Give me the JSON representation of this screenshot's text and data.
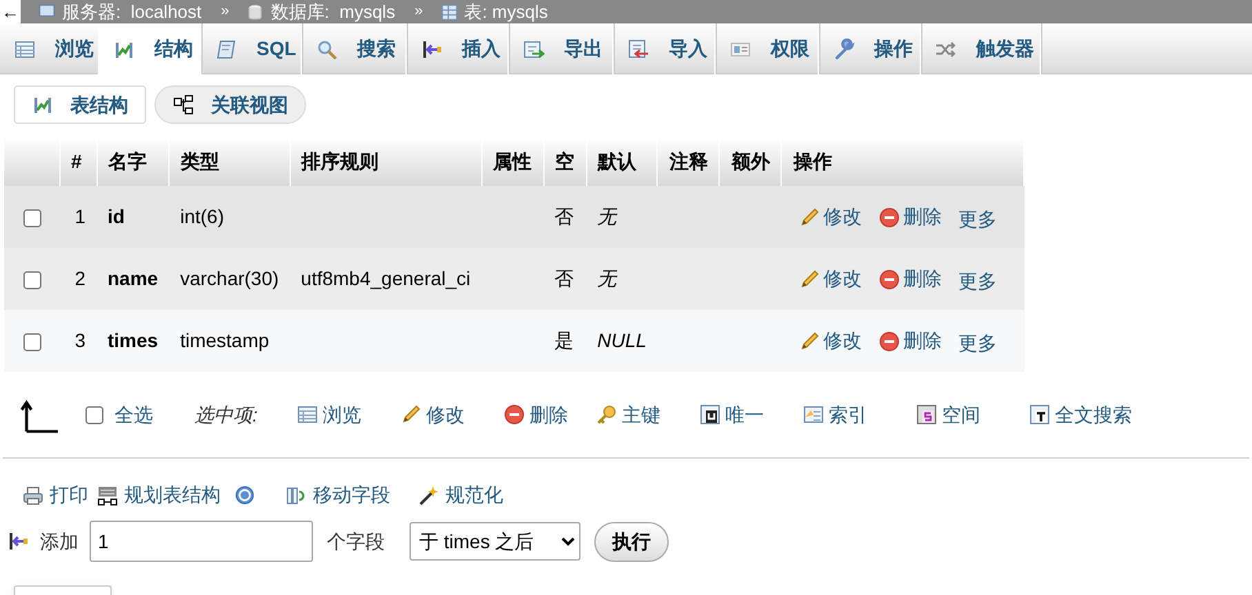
{
  "breadcrumb": {
    "back": "←",
    "items": [
      {
        "label": "服务器:",
        "value": "localhost",
        "separator": "»"
      },
      {
        "label": "数据库:",
        "value": "mysqls",
        "separator": "»"
      },
      {
        "label": "表:",
        "value": "mysqls"
      }
    ]
  },
  "tabs": [
    {
      "label": "浏览",
      "selected": false
    },
    {
      "label": "结构",
      "selected": true
    },
    {
      "label": "SQL",
      "selected": false
    },
    {
      "label": "搜索",
      "selected": false
    },
    {
      "label": "插入",
      "selected": false
    },
    {
      "label": "导出",
      "selected": false
    },
    {
      "label": "导入",
      "selected": false
    },
    {
      "label": "权限",
      "selected": false
    },
    {
      "label": "操作",
      "selected": false
    },
    {
      "label": "触发器",
      "selected": false
    }
  ],
  "subtabs": [
    {
      "label": "表结构",
      "selected": true
    },
    {
      "label": "关联视图",
      "selected": false
    }
  ],
  "table": {
    "columns": [
      "#",
      "名字",
      "类型",
      "排序规则",
      "属性",
      "空",
      "默认",
      "注释",
      "额外",
      "操作"
    ],
    "rows": [
      {
        "checked": false,
        "number": "1",
        "name": "id",
        "type": "int(6)",
        "collation": "",
        "null": "否",
        "default": "无",
        "actions": [
          "修改",
          "删除",
          "更多"
        ]
      },
      {
        "checked": false,
        "number": "2",
        "name": "name",
        "type": "varchar(30)",
        "collation": "utf8mb4_general_ci",
        "null": "否",
        "default": "无",
        "actions": [
          "修改",
          "删除",
          "更多"
        ]
      },
      {
        "checked": false,
        "number": "3",
        "name": "times",
        "type": "timestamp",
        "collation": "",
        "null": "是",
        "default": "NULL",
        "actions": [
          "修改",
          "删除",
          "更多"
        ]
      }
    ]
  },
  "bulk": {
    "check_all": {
      "label": "全选",
      "checked": false
    },
    "with_selected": "选中项:",
    "actions": [
      "浏览",
      "修改",
      "删除",
      "主键",
      "唯一",
      "索引",
      "空间",
      "全文搜索"
    ]
  },
  "tools": [
    "打印",
    "规划表结构",
    "移动字段",
    "规范化"
  ],
  "add_fields": {
    "label": "添加",
    "value": "1",
    "unit": "个字段",
    "position": "于 times 之后",
    "button": "执行"
  }
}
